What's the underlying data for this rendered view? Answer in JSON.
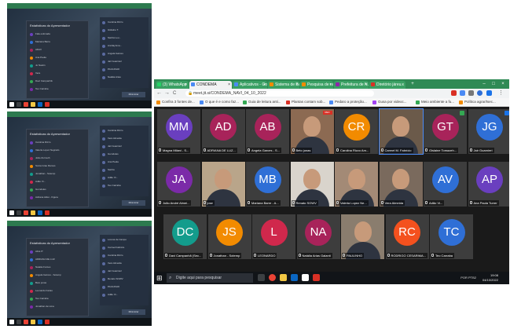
{
  "window": {
    "tabs": [
      {
        "label": "(3) WhatsApp",
        "color": "#25d366",
        "active": false
      },
      {
        "label": "CONDEMA",
        "color": "#4a8af4",
        "active": true
      },
      {
        "label": "Aplicativos - Go...",
        "color": "#4a8af4",
        "active": false
      },
      {
        "label": "Sistema de Ban...",
        "color": "#f28b00",
        "active": false
      },
      {
        "label": "Pesquisa de no...",
        "color": "#f28b00",
        "active": false
      },
      {
        "label": "Prefeitura de N...",
        "color": "#8e24aa",
        "active": false
      },
      {
        "label": "Diretório járeu...",
        "color": "#d93025",
        "active": false
      }
    ],
    "new_tab": "+",
    "controls": {
      "minimize": "–",
      "maximize": "□",
      "close": "×"
    }
  },
  "address_bar": {
    "back": "←",
    "forward": "→",
    "reload": "C",
    "url": "meet.jit.si/CONDEMA_NAVI_04_10_2022",
    "lock": "🔒"
  },
  "bookmarks": [
    "Confira 3 fontes de...",
    "O que é e como faz...",
    "Guia de leitura anti...",
    "Plantas contam sob...",
    "Pedaro a proteção...",
    "Gusa por videoc...",
    "Meio ambiente a fu...",
    "Política agrar/tsec..."
  ],
  "meeting": {
    "logo": "jitsi",
    "recording_label": "REC",
    "participants": [
      {
        "initials": "MM",
        "name": "Magna Milani - S...",
        "color": "#6a3fbf",
        "video": false
      },
      {
        "initials": "AD",
        "name": "ADRIANA DE LUZ...",
        "color": "#a8235a",
        "video": false
      },
      {
        "initials": "AB",
        "name": "Angela Garces - S...",
        "color": "#a8235a",
        "video": false
      },
      {
        "initials": "",
        "name": "Beto jonas",
        "color": "#8c6a52",
        "video": true
      },
      {
        "initials": "CR",
        "name": "Carolina Rizzo Am...",
        "color": "#f28b00",
        "video": false
      },
      {
        "initials": "",
        "name": "Carmel M. Fabrício",
        "color": "#6b5a4a",
        "video": true
      },
      {
        "initials": "GT",
        "name": "Gislaine Tomazeh...",
        "color": "#a8235a",
        "video": false
      },
      {
        "initials": "JG",
        "name": "Jair Guarnieri",
        "color": "#2f6fd6",
        "video": false
      },
      {
        "initials": "JA",
        "name": "João André Almei...",
        "color": "#7b2aa8",
        "video": false
      },
      {
        "initials": "",
        "name": "jose",
        "color": "#b9a58a",
        "video": true
      },
      {
        "initials": "MB",
        "name": "Mariana Barre - A...",
        "color": "#2f6fd6",
        "video": false
      },
      {
        "initials": "",
        "name": "Renato SOWV",
        "color": "#d9d4cc",
        "video": true
      },
      {
        "initials": "",
        "name": "Valeria Lopez Ne...",
        "color": "#a38a76",
        "video": true
      },
      {
        "initials": "",
        "name": "Vera Almeida",
        "color": "#7a6a5d",
        "video": true
      },
      {
        "initials": "AV",
        "name": "Adão Vi...",
        "color": "#2f6fd6",
        "video": false
      },
      {
        "initials": "AP",
        "name": "Ana Paula Turrer",
        "color": "#6a3fbf",
        "video": false
      },
      {
        "initials": "DC",
        "name": "Davi Campanhã (Sec...",
        "color": "#139c8c",
        "video": false
      },
      {
        "initials": "JS",
        "name": "Jonathan - Sotemp",
        "color": "#f28b00",
        "video": false
      },
      {
        "initials": "L",
        "name": "LEONARDO",
        "color": "#d0284c",
        "video": false
      },
      {
        "initials": "NA",
        "name": "Natália Arias Galanti",
        "color": "#a8235a",
        "video": false
      },
      {
        "initials": "",
        "name": "PAULINHO",
        "color": "#8a7d6e",
        "video": true
      },
      {
        "initials": "RC",
        "name": "RODRIGO CESARIMA...",
        "color": "#f4511e",
        "video": false
      },
      {
        "initials": "TC",
        "name": "Teo Carraba",
        "color": "#2f6fd6",
        "video": false
      }
    ]
  },
  "taskbar": {
    "start": "⊞",
    "search_placeholder": "Digite aqui para pesquisar",
    "time": "19:08",
    "date": "04/10/2022",
    "lang": "POR PTB2"
  },
  "thumbnails": [
    {
      "panel_title": "Estatísticas do Apresentador",
      "button_label": "Minimizar",
      "rows": [
        "Fala estimada",
        "Mariana Barre",
        "ADAV",
        "Ana Paula",
        "Jo Nastin",
        "Vera",
        "Davi Campanhã",
        "Teo Carraba"
      ],
      "right_rows": [
        "Carolina Rizzo",
        "Gislaine T.",
        "Sanha Leu...",
        "Ancilaj Ama...",
        "Angela Garces",
        "Jair Guarnieri",
        "PAULINHO",
        "Natália Arias"
      ]
    },
    {
      "panel_title": "Estatísticas do Apresentador",
      "button_label": "Minimizar",
      "rows": [
        "Carolina Rizzo",
        "Valeria Lopez Negrado",
        "João Zurmuth",
        "Sonia Grau Ramos",
        "Jonathan - Sotemp",
        "Adão Vi...",
        "Gumdoles",
        "Adriana Aldei - Figura"
      ],
      "right_rows": [
        "Carolina Rizzo",
        "Vera Almeida",
        "Jair Guarnieri",
        "Gumdoles",
        "Ana Paula",
        "Sanha",
        "Adão Vi...",
        "Teo Carraba"
      ]
    },
    {
      "panel_title": "Estatísticas do Apresentador",
      "button_label": "Minimizar",
      "rows": [
        "Abra IT",
        "ADRIANA DE LUZ",
        "Natalia Fontes",
        "Angela Garces - Sotemp",
        "Beto jonas",
        "Leonardo Farias",
        "Teo Carraba",
        "Jonathan de Lima"
      ],
      "right_rows": [
        "Lorena de Campo",
        "Carmel Fabrício",
        "Carolina Rizzo",
        "Vera Almeida",
        "Jair Guarnieri",
        "Renato SOWV",
        "PAULINHO",
        "Adão Vi..."
      ]
    }
  ]
}
